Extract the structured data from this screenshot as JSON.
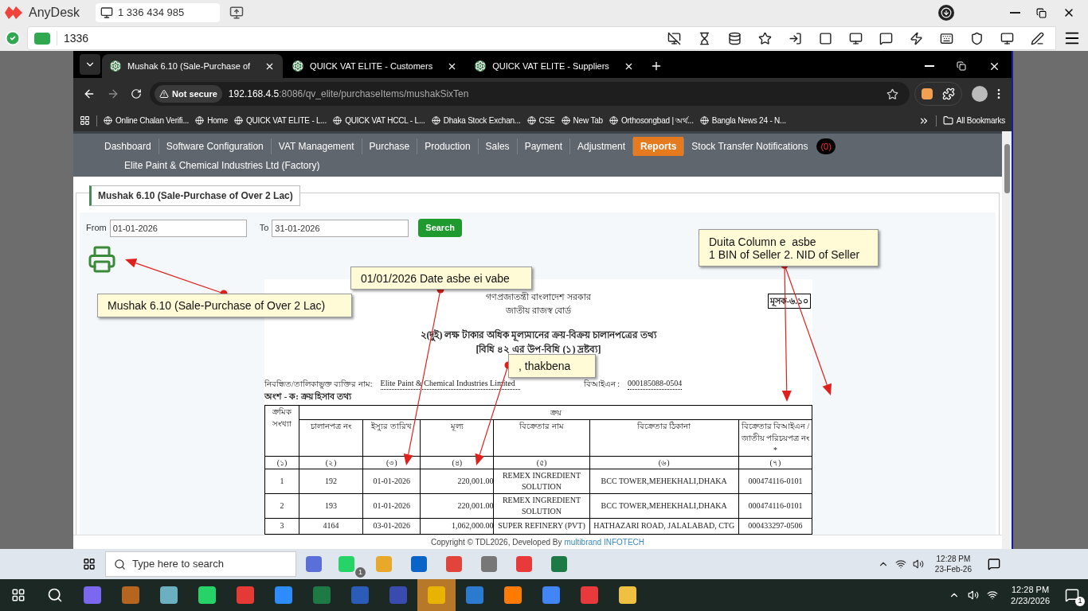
{
  "anydesk": {
    "app_name": "AnyDesk",
    "session_tab": "1 336 434 985",
    "address": "1336"
  },
  "browser": {
    "tabs": [
      {
        "title": "Mushak 6.10 (Sale-Purchase of",
        "selected": true
      },
      {
        "title": "QUICK VAT ELITE - Customers",
        "selected": false
      },
      {
        "title": "QUICK VAT ELITE - Suppliers",
        "selected": false
      }
    ],
    "security": "Not secure",
    "url_host": "192.168.4.5",
    "url_path": ":8086/qv_elite/purchaseItems/mushakSixTen",
    "bookmarks": [
      "Online Chalan Verifi...",
      "Home",
      "QUICK VAT ELITE - L...",
      "QUICK VAT HCCL - L...",
      "Dhaka Stock Exchan...",
      "CSE",
      "New Tab",
      "Orthosongbad | অর্থ...",
      "Bangla News 24 - N..."
    ],
    "all_bookmarks": "All Bookmarks"
  },
  "nav": {
    "items": [
      {
        "label": "Dashboard",
        "selected": false
      },
      {
        "label": "Software Configuration",
        "selected": false
      },
      {
        "label": "VAT Management",
        "selected": false
      },
      {
        "label": "Purchase",
        "selected": false
      },
      {
        "label": "Production",
        "selected": false
      },
      {
        "label": "Sales",
        "selected": false
      },
      {
        "label": "Payment",
        "selected": false
      },
      {
        "label": "Adjustment",
        "selected": false
      },
      {
        "label": "Reports",
        "selected": true
      },
      {
        "label": "Stock Transfer Notifications",
        "selected": false,
        "badge": "(0)"
      }
    ],
    "company": "Elite Paint & Chemical Industries Ltd (Factory)"
  },
  "panel_title": "Mushak 6.10 (Sale-Purchase of Over 2 Lac)",
  "filter": {
    "from_label": "From",
    "from_value": "01-01-2026",
    "to_label": "To",
    "to_value": "31-01-2026",
    "search_button": "Search"
  },
  "report": {
    "gov_line": "গণপ্রজাতন্ত্রী বাংলাদেশ সরকার",
    "board_line": "জাতীয় রাজস্ব বোর্ড",
    "form_code": "মূসক-৬.১০",
    "title": "২(দুই) লক্ষ টাকার অধিক মূল্যমানের ক্রয়-বিক্রয় চালানপত্রের তথ্য",
    "subtitle": "[বিধি ৪২ এর উপ-বিধি (১) দ্রষ্টব্য]",
    "name_label": "নিবন্ধিত/তালিকাভুক্ত ব্যক্তির নাম:",
    "name_value": "Elite Paint & Chemical Industries Limited",
    "bin_label": "বিআইএন :",
    "bin_value": "000185088-0504",
    "section": "অংশ - ক: ক্রয় হিসাব তথ্য"
  },
  "table": {
    "group_header": "ক্রয়",
    "columns": [
      "ক্রমিক সংখ্যা",
      "চালানপত্র নং",
      "ইস্যুর তারিখ",
      "মূল্য",
      "বিক্রেতার নাম",
      "বিক্রেতার ঠিকানা",
      "বিক্রেতার বিআইএন / জাতীয় পরিচয়পত্র নং *"
    ],
    "column_numbers": [
      "(১)",
      "(২)",
      "(৩)",
      "(৪)",
      "(৫)",
      "(৬)",
      "(৭)"
    ],
    "rows": [
      [
        "1",
        "192",
        "01-01-2026",
        "220,001.00",
        "REMEX INGREDIENT SOLUTION",
        "BCC TOWER,MEHEKHALI,DHAKA",
        "000474116-0101"
      ],
      [
        "2",
        "193",
        "01-01-2026",
        "220,001.00",
        "REMEX INGREDIENT SOLUTION",
        "BCC TOWER,MEHEKHALI,DHAKA",
        "000474116-0101"
      ],
      [
        "3",
        "4164",
        "03-01-2026",
        "1,062,000.00",
        "SUPER REFINERY (PVT)",
        "HATHAZARI ROAD, JALALABAD, CTG",
        "000433297-0506"
      ]
    ]
  },
  "footer": {
    "text": "Copyright © TDL2026, Developed By",
    "link": "multibrand INFOTECH"
  },
  "annotations": [
    {
      "lines": [
        "Mushak 6.10 (Sale-Purchase of Over 2 Lac)"
      ]
    },
    {
      "lines": [
        "01/01/2026 Date asbe ei vabe"
      ]
    },
    {
      "lines": [
        ", thakbena"
      ]
    },
    {
      "lines": [
        "Duita Column e  asbe",
        "1 BIN of Seller 2. NID of Seller"
      ]
    }
  ],
  "remote_taskbar": {
    "search_placeholder": "Type here to search",
    "whatsapp_badge": "1",
    "time": "12:28 PM",
    "date": "23-Feb-26"
  },
  "local_taskbar": {
    "time": "12:28 PM",
    "date": "2/23/2026",
    "notification_count": "1"
  }
}
